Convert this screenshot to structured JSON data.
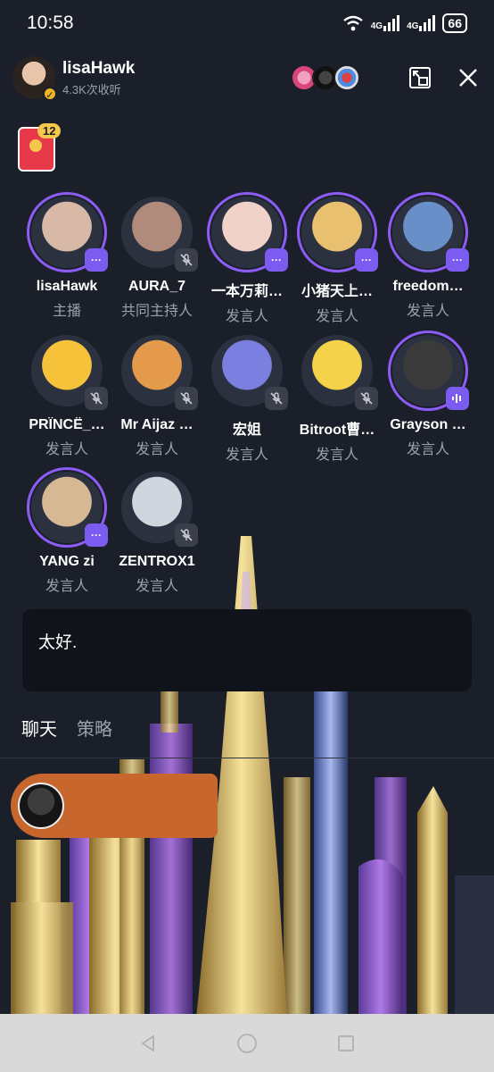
{
  "status_bar": {
    "time": "10:58",
    "signal1_label": "4G",
    "signal2_label": "4G",
    "battery": "66"
  },
  "header": {
    "host_name": "lisaHawk",
    "listeners": "4.3K次收听"
  },
  "gift": {
    "count": "12"
  },
  "speakers": [
    {
      "name": "lisaHawk",
      "role": "主播",
      "badge": "dots",
      "ring": true,
      "color": "#d8b9a8"
    },
    {
      "name": "AURA_7",
      "role": "共同主持人",
      "badge": "muted",
      "ring": false,
      "color": "#b08a7a"
    },
    {
      "name": "一本万莉…",
      "role": "发言人",
      "badge": "dots",
      "ring": true,
      "color": "#f0d2c8"
    },
    {
      "name": "小猪天上…",
      "role": "发言人",
      "badge": "dots",
      "ring": true,
      "color": "#e8c070"
    },
    {
      "name": "freedom…",
      "role": "发言人",
      "badge": "dots",
      "ring": true,
      "color": "#6a8fc8"
    },
    {
      "name": "PRÏNCË_…",
      "role": "发言人",
      "badge": "muted",
      "ring": false,
      "color": "#f5c23a"
    },
    {
      "name": "Mr Aijaz …",
      "role": "发言人",
      "badge": "muted",
      "ring": false,
      "color": "#e39a4a"
    },
    {
      "name": "宏姐",
      "role": "发言人",
      "badge": "muted",
      "ring": false,
      "color": "#7a7fe0"
    },
    {
      "name": "Bitroot曹…",
      "role": "发言人",
      "badge": "muted",
      "ring": false,
      "color": "#f4d24a"
    },
    {
      "name": "Grayson …",
      "role": "发言人",
      "badge": "speaking",
      "ring": true,
      "color": "#3a3a3a"
    },
    {
      "name": "YANG  zi",
      "role": "发言人",
      "badge": "dots",
      "ring": true,
      "color": "#d7b894"
    },
    {
      "name": "ZENTROX1",
      "role": "发言人",
      "badge": "muted",
      "ring": false,
      "color": "#cfd6dd"
    }
  ],
  "message": {
    "text": "太好."
  },
  "tabs": [
    {
      "label": "聊天",
      "active": true
    },
    {
      "label": "策略",
      "active": false
    }
  ],
  "colors": {
    "accent": "#7c5cf0",
    "background": "#1b1f29",
    "gift": "#e8394a"
  }
}
